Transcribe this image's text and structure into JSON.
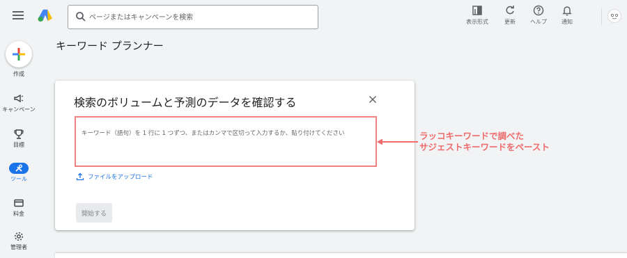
{
  "topbar": {
    "search_placeholder": "ページまたはキャンペーンを検索",
    "tools": [
      {
        "label": "表示形式",
        "icon": "appearance-icon"
      },
      {
        "label": "更新",
        "icon": "refresh-icon"
      },
      {
        "label": "ヘルプ",
        "icon": "help-icon"
      },
      {
        "label": "通知",
        "icon": "bell-icon"
      }
    ]
  },
  "sidebar": {
    "create_label": "作成",
    "items": [
      {
        "label": "キャンペーン",
        "icon": "megaphone-icon"
      },
      {
        "label": "目標",
        "icon": "trophy-icon"
      },
      {
        "label": "ツール",
        "icon": "tools-icon",
        "active": true
      },
      {
        "label": "料金",
        "icon": "credit-card-icon"
      },
      {
        "label": "管理者",
        "icon": "gear-icon"
      }
    ]
  },
  "main": {
    "page_title": "キーワード プランナー",
    "card": {
      "title": "検索のボリュームと予測のデータを確認する",
      "textarea_placeholder": "キーワード（語句）を 1 行に 1 つずつ、またはカンマで区切って入力するか、貼り付けてください",
      "upload_label": "ファイルをアップロード",
      "start_button": "開始する"
    }
  },
  "annotation": {
    "line1": "ラッコキーワードで調べた",
    "line2": "サジェストキーワードをペースト",
    "color": "#f06b6b"
  },
  "colors": {
    "accent": "#1a73e8",
    "highlight_border": "#f08080"
  }
}
